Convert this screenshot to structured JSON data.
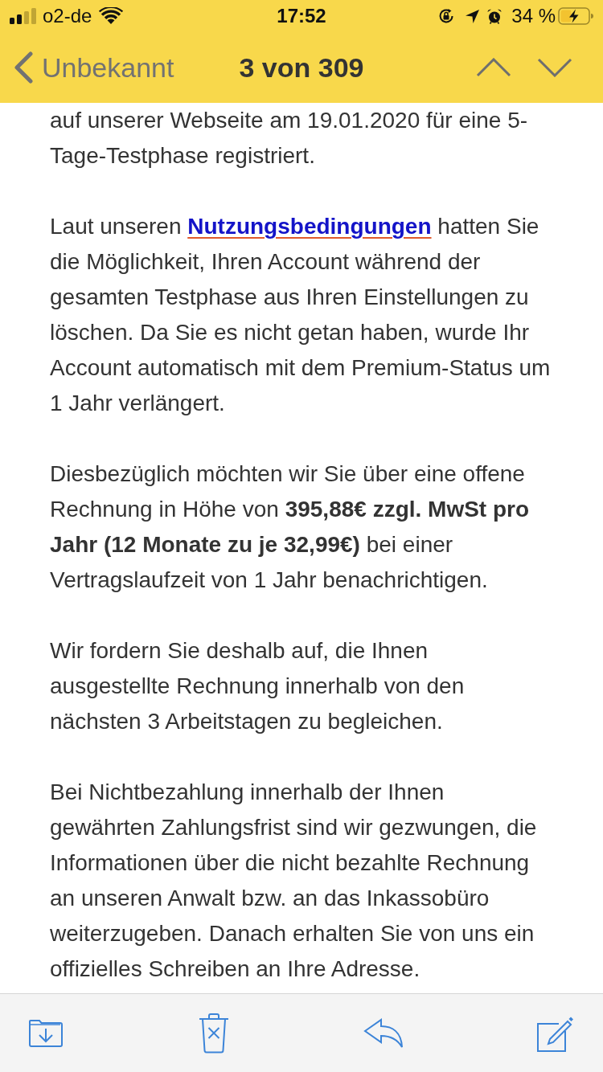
{
  "status_bar": {
    "carrier": "o2-de",
    "time": "17:52",
    "battery_percent": "34 %"
  },
  "nav_bar": {
    "back_label": "Unbekannt",
    "title": "3 von 309"
  },
  "email_body": {
    "paragraphs": [
      {
        "parts": [
          {
            "kind": "text",
            "text": "auf unserer Webseite am 19.01.2020 für eine 5-Tage-Testphase registriert."
          }
        ]
      },
      {
        "parts": [
          {
            "kind": "text",
            "text": "Laut unseren "
          },
          {
            "kind": "link",
            "text": "Nutzungsbedingungen"
          },
          {
            "kind": "text",
            "text": " hatten Sie die Möglichkeit, Ihren Account während der gesamten Testphase aus Ihren Einstellungen zu löschen. Da Sie es nicht getan haben, wurde Ihr Account automatisch mit dem Premium-Status um 1 Jahr verlängert."
          }
        ]
      },
      {
        "parts": [
          {
            "kind": "text",
            "text": "Diesbezüglich möchten wir Sie über eine offene Rechnung in Höhe von **395,88€ zzgl. MwSt pro Jahr (12 Monate zu je 32,99€)** bei einer Vertragslaufzeit von 1 Jahr benachrichtigen."
          }
        ]
      },
      {
        "parts": [
          {
            "kind": "text",
            "text": "Wir fordern Sie deshalb auf, die Ihnen ausgestellte Rechnung innerhalb von den nächsten 3 Arbeitstagen zu begleichen."
          }
        ]
      },
      {
        "parts": [
          {
            "kind": "text",
            "text": "Bei Nichtbezahlung innerhalb der Ihnen gewährten Zahlungsfrist sind wir gezwungen, die Informationen über die nicht bezahlte Rechnung an unseren Anwalt bzw. an das Inkassobüro weiterzugeben. Danach erhalten Sie von uns ein offizielles Schreiben an Ihre Adresse."
          }
        ]
      }
    ]
  }
}
